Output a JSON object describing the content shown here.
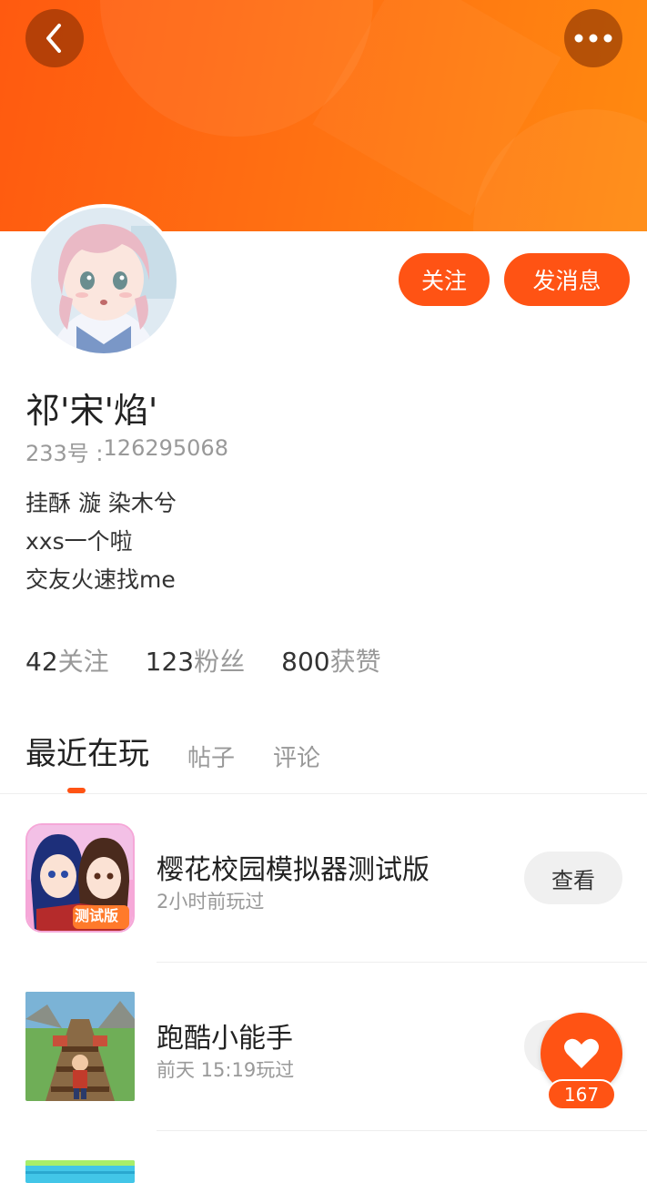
{
  "header": {
    "back_icon": "chevron-left-icon",
    "more_icon": "more-dots-icon"
  },
  "profile": {
    "avatar": "anime-girl-avatar",
    "username": "祁'宋'焰'",
    "uid_label": "233号 : ",
    "uid_value": "126295068",
    "bio": [
      "挂酥 漩 染木兮",
      "xxs一个啦",
      "交友火速找me"
    ]
  },
  "actions": {
    "follow_label": "关注",
    "message_label": "发消息"
  },
  "stats": [
    {
      "num": "42",
      "label": "关注"
    },
    {
      "num": "123",
      "label": "粉丝"
    },
    {
      "num": "800",
      "label": "获赞"
    }
  ],
  "tabs": [
    {
      "label": "最近在玩",
      "active": true
    },
    {
      "label": "帖子",
      "active": false
    },
    {
      "label": "评论",
      "active": false
    }
  ],
  "games": [
    {
      "name": "樱花校园模拟器测试版",
      "time": "2小时前玩过",
      "button": "查看",
      "icon_badge": "测试版"
    },
    {
      "name": "跑酷小能手",
      "time": "前天 15:19玩过",
      "button": "查看"
    }
  ],
  "like": {
    "icon": "heart-icon",
    "count": "167"
  },
  "colors": {
    "accent": "#ff5314",
    "banner_start": "#ff5a10",
    "banner_end": "#ff8a10"
  }
}
